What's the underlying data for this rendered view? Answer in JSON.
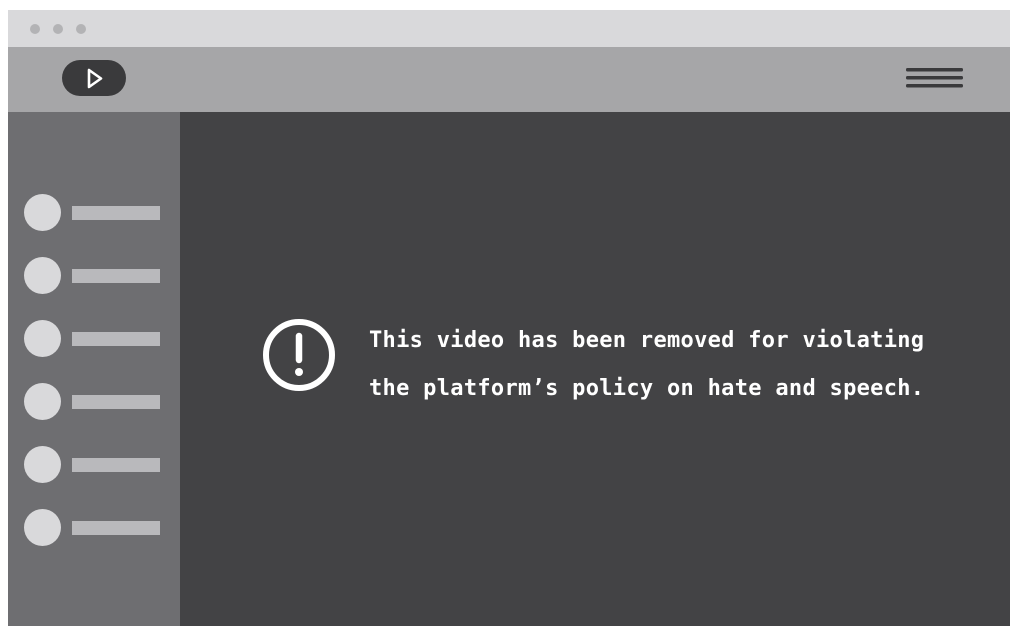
{
  "window": {
    "title_bar_controls": [
      "dot",
      "dot",
      "dot"
    ]
  },
  "header": {
    "logo_icon": "play-icon",
    "menu_icon": "hamburger-menu-icon"
  },
  "sidebar": {
    "item_count": 6
  },
  "main": {
    "alert_icon": "exclamation-circle-icon",
    "message_line1": "This video has been removed for violating",
    "message_line2": "the platform’s policy on hate and speech."
  },
  "colors": {
    "titlebar": "#d9d9db",
    "navbar": "#a6a6a8",
    "sidebar": "#6e6e71",
    "main_background": "#434345",
    "text": "#ffffff"
  }
}
